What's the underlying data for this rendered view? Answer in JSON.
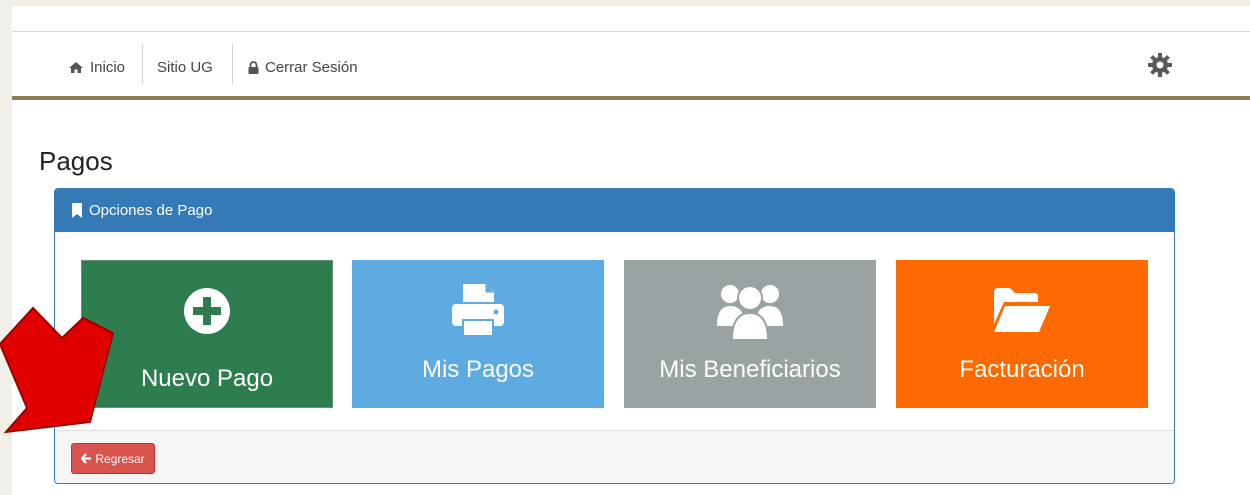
{
  "nav": {
    "home_label": "Inicio",
    "site_label": "Sitio UG",
    "logout_label": "Cerrar Sesión"
  },
  "page_title": "Pagos",
  "panel": {
    "heading": "Opciones de Pago",
    "tiles": [
      {
        "label": "Nuevo Pago",
        "icon": "plus-circle-icon",
        "color": "#2e7d4f"
      },
      {
        "label": "Mis Pagos",
        "icon": "printer-icon",
        "color": "#5dabe0"
      },
      {
        "label": "Mis Beneficiarios",
        "icon": "users-icon",
        "color": "#9aa3a3"
      },
      {
        "label": "Facturación",
        "icon": "folder-open-icon",
        "color": "#ff6a00"
      }
    ],
    "back_label": "Regresar"
  },
  "colors": {
    "panel_header": "#347ab7",
    "nav_underline": "#8a7e56",
    "back_button": "#d9534f",
    "annotation_arrow": "#ff0000"
  }
}
